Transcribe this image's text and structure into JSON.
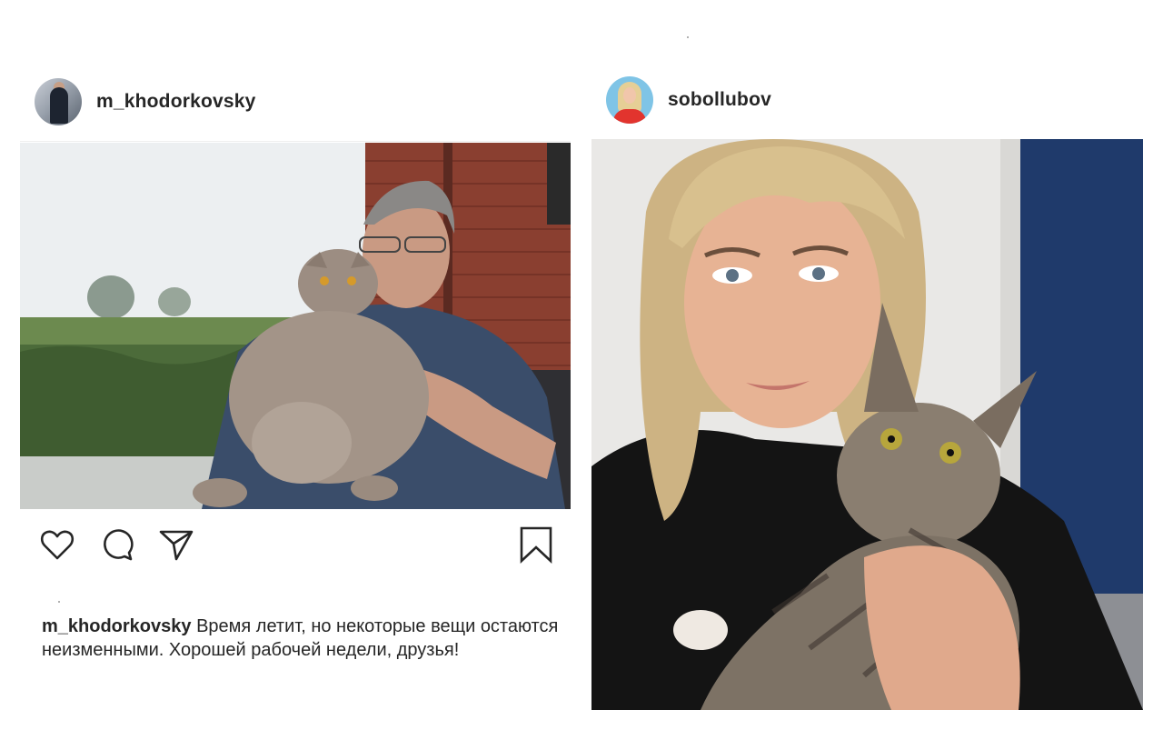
{
  "posts": [
    {
      "username": "m_khodorkovsky",
      "caption_username": "m_khodorkovsky",
      "caption_text": "Время летит, но некоторые вещи остаются неизменными. Хорошей рабочей недели, друзья!",
      "actions": {
        "like_icon": "heart-icon",
        "comment_icon": "comment-icon",
        "share_icon": "paper-plane-icon",
        "save_icon": "bookmark-icon"
      }
    },
    {
      "username": "sobollubov"
    }
  ],
  "colors": {
    "text": "#262626",
    "divider": "#efefef",
    "background": "#ffffff"
  }
}
